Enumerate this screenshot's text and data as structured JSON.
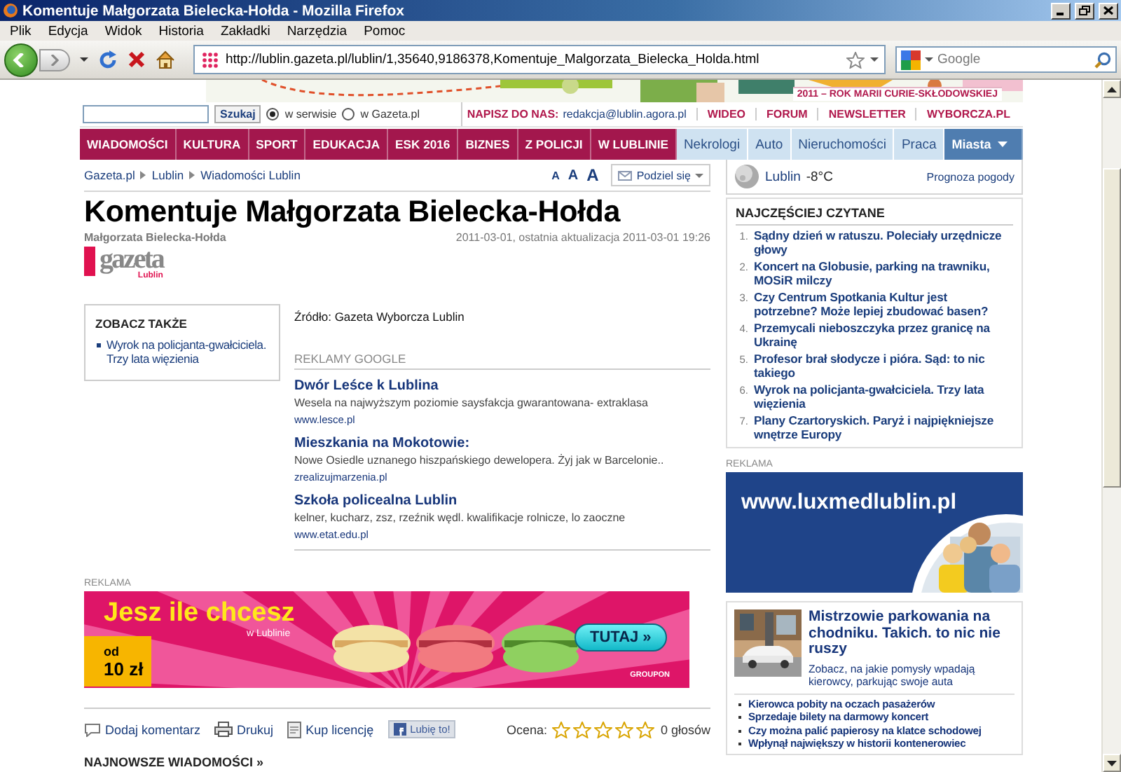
{
  "window": {
    "title": "Komentuje Małgorzata Bielecka-Hołda - Mozilla Firefox"
  },
  "menu": [
    "Plik",
    "Edycja",
    "Widok",
    "Historia",
    "Zakładki",
    "Narzędzia",
    "Pomoc"
  ],
  "toolbar": {
    "address": "http://lublin.gazeta.pl/lublin/1,35640,9186378,Komentuje_Malgorzata_Bielecka_Holda.html",
    "search_placeholder": "Google"
  },
  "banner": {
    "label": "2011 – ROK MARII CURIE-SKŁODOWSKIEJ"
  },
  "search": {
    "button": "Szukaj",
    "scopes": [
      {
        "label": "w serwisie",
        "selected": true
      },
      {
        "label": "w Gazeta.pl",
        "selected": false
      }
    ]
  },
  "top_links": {
    "contact_label": "NAPISZ DO NAS:",
    "contact_email": "redakcja@lublin.agora.pl",
    "links": [
      "WIDEO",
      "FORUM",
      "NEWSLETTER",
      "WYBORCZA.PL"
    ]
  },
  "nav": [
    {
      "label": "WIADOMOŚCI",
      "kind": "section"
    },
    {
      "label": "KULTURA",
      "kind": "section"
    },
    {
      "label": "SPORT",
      "kind": "section"
    },
    {
      "label": "EDUKACJA",
      "kind": "section"
    },
    {
      "label": "ESK 2016",
      "kind": "section"
    },
    {
      "label": "BIZNES",
      "kind": "section"
    },
    {
      "label": "Z POLICJI",
      "kind": "section"
    },
    {
      "label": "W LUBLINIE",
      "kind": "section"
    },
    {
      "label": "Nekrologi",
      "kind": "service"
    },
    {
      "label": "Auto",
      "kind": "service"
    },
    {
      "label": "Nieruchomości",
      "kind": "service"
    },
    {
      "label": "Praca",
      "kind": "service"
    },
    {
      "label": "Miasta",
      "kind": "cities"
    }
  ],
  "breadcrumbs": [
    "Gazeta.pl",
    "Lublin",
    "Wiadomości Lublin"
  ],
  "font_sizes": [
    "A",
    "A",
    "A"
  ],
  "share": "Podziel się",
  "article": {
    "title": "Komentuje Małgorzata Bielecka-Hołda",
    "author": "Małgorzata Bielecka-Hołda",
    "date": "2011-03-01, ostatnia aktualizacja 2011-03-01 19:26",
    "logo": {
      "name": "gazeta",
      "city": "Lublin"
    },
    "source": "Źródło: Gazeta Wyborcza Lublin"
  },
  "see_also": {
    "heading": "ZOBACZ TAKŻE",
    "items": [
      "Wyrok na policjanta-gwałciciela. Trzy lata więzienia"
    ]
  },
  "google_ads": {
    "heading": "REKLAMY GOOGLE",
    "ads": [
      {
        "title": "Dwór Leśce k Lublina",
        "text": "Wesela na najwyższym poziomie saysfakcja gwarantowana- extraklasa",
        "url": "www.lesce.pl"
      },
      {
        "title": "Mieszkania na Mokotowie:",
        "text": "Nowe Osiedle uznanego hiszpańskiego dewelopera. Żyj jak w Barcelonie..",
        "url": "zrealizujmarzenia.pl"
      },
      {
        "title": "Szkoła policealna Lublin",
        "text": "kelner, kucharz, zsz, rzeźnik wędl. kwalifikacje rolnicze, lo zaoczne",
        "url": "www.etat.edu.pl"
      }
    ]
  },
  "ad_banner": {
    "label": "REKLAMA",
    "headline": "Jesz ile chcesz",
    "subline": "w Lublinie",
    "price_prefix": "od",
    "price": "10 zł",
    "button": "TUTAJ »",
    "brand": "GROUPON"
  },
  "actions": [
    {
      "label": "Dodaj komentarz",
      "kind": "comment"
    },
    {
      "label": "Drukuj",
      "kind": "print"
    },
    {
      "label": "Kup licencję",
      "kind": "license"
    },
    {
      "label": "Lubię to!",
      "kind": "like"
    }
  ],
  "rating": {
    "label": "Ocena:",
    "stars": 0,
    "votes": "0 głosów"
  },
  "latest": {
    "heading": "NAJNOWSZE WIADOMOŚCI »"
  },
  "weather": {
    "city": "Lublin",
    "temperature": "-8°C",
    "link": "Prognoza pogody"
  },
  "most_read": {
    "heading": "NAJCZĘŚCIEJ CZYTANE",
    "items": [
      {
        "number": "1.",
        "title": "Sądny dzień w ratuszu. Poleciały urzędnicze głowy"
      },
      {
        "number": "2.",
        "title": "Koncert na Globusie, parking na trawniku, MOSiR milczy"
      },
      {
        "number": "3.",
        "title": "Czy Centrum Spotkania Kultur jest potrzebne? Może lepiej zbudować basen?"
      },
      {
        "number": "4.",
        "title": "Przemycali nieboszczyka przez granicę na Ukrainę"
      },
      {
        "number": "5.",
        "title": "Profesor brał słodycze i pióra. Sąd: to nic takiego"
      },
      {
        "number": "6.",
        "title": "Wyrok na policjanta-gwałciciela. Trzy lata więzienia"
      },
      {
        "number": "7.",
        "title": "Plany Czartoryskich. Paryż i najpiękniejsze wnętrze Europy"
      }
    ]
  },
  "side_ad": {
    "label": "REKLAMA",
    "url": "www.luxmedlublin.pl"
  },
  "feature": {
    "title": "Mistrzowie parkowania na chodniku. Takich. to nic nie ruszy",
    "lead": "Zobacz, na jakie pomysły wpadają kierowcy, parkując swoje auta",
    "links": [
      "Kierowca pobity na oczach pasażerów",
      "Sprzedaje bilety na darmowy koncert",
      "Czy można palić papierosy na klatce schodowej",
      "Wpłynął największy w historii kontenerowiec"
    ]
  }
}
